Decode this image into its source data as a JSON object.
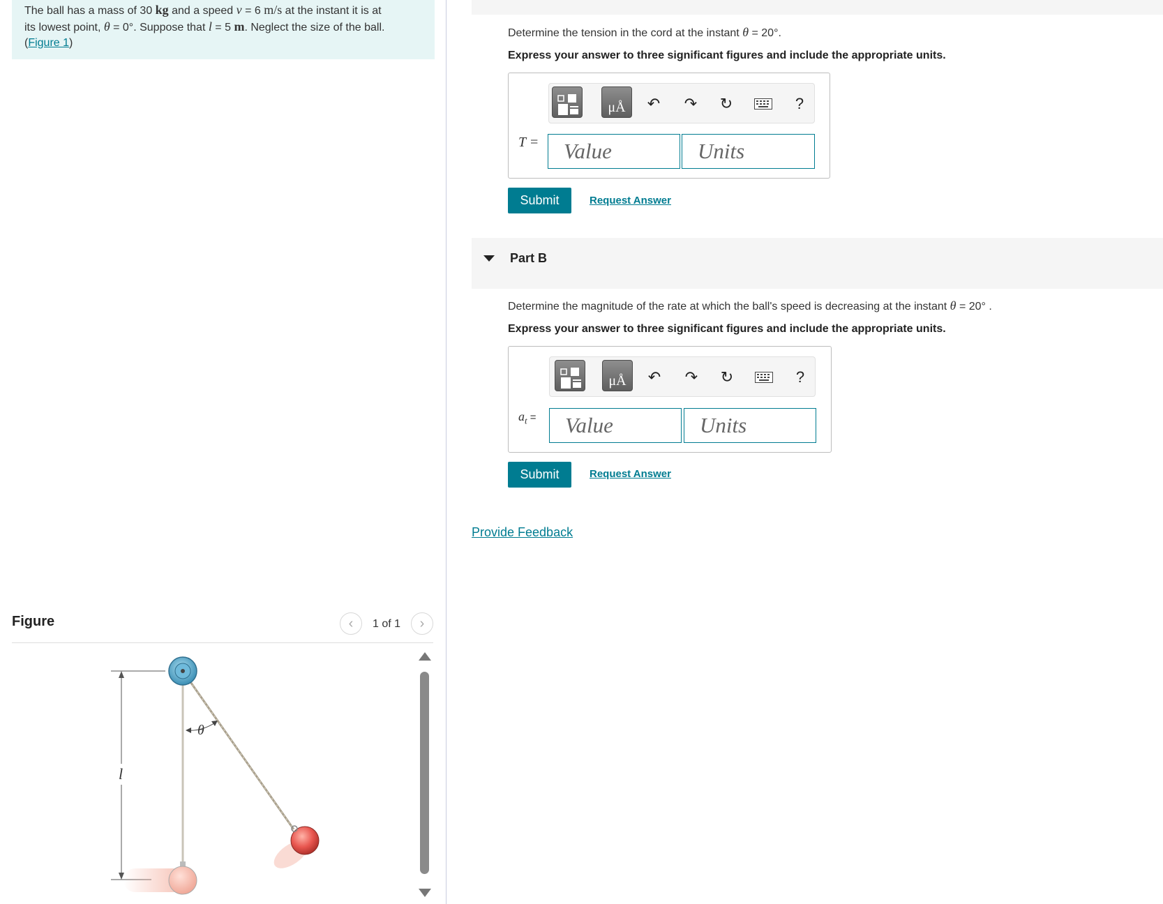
{
  "problem": {
    "text_1": "The ball has a mass of 30 ",
    "mass_unit": "kg",
    "text_2": " and a speed ",
    "speed_var": "v",
    "text_3": " = 6 ",
    "speed_unit": "m/s",
    "text_4": " at the instant it is at",
    "text_5": "its lowest point, ",
    "theta": "θ",
    "text_6": " = 0°. Suppose that ",
    "length_var": "l",
    "text_7": " = 5 ",
    "length_unit": "m",
    "text_8": ". Neglect the size of the ball.",
    "figure_open": "(",
    "figure_link": "Figure 1",
    "figure_close": ")"
  },
  "figure": {
    "title": "Figure",
    "count": "1 of 1",
    "prev_icon": "chevron-left-icon",
    "next_icon": "chevron-right-icon",
    "label_theta": "θ",
    "label_l": "l"
  },
  "part_a": {
    "question_1": "Determine the tension in the cord at the instant ",
    "theta": "θ",
    "question_2": " = 20°.",
    "instructions": "Express your answer to three significant figures and include the appropriate units.",
    "var_label": "T =",
    "value_placeholder": "Value",
    "units_placeholder": "Units",
    "submit_label": "Submit",
    "request_label": "Request Answer"
  },
  "part_b": {
    "title": "Part B",
    "question_1": "Determine the magnitude of the rate at which the ball's speed is decreasing at the instant ",
    "theta": "θ",
    "question_2": " = 20° .",
    "instructions": "Express your answer to three significant figures and include the appropriate units.",
    "var_label": "a",
    "var_sub": "t",
    "var_eq": " =",
    "value_placeholder": "Value",
    "units_placeholder": "Units",
    "submit_label": "Submit",
    "request_label": "Request Answer"
  },
  "toolbar": {
    "units_glyph": "μÅ",
    "help": "?",
    "icons": [
      "templates-icon",
      "units-icon",
      "undo-icon",
      "redo-icon",
      "reset-icon",
      "keyboard-icon",
      "help-icon"
    ]
  },
  "feedback_label": "Provide Feedback",
  "colors": {
    "accent": "#007c91",
    "problem_bg": "#e6f5f5",
    "ball": "#e8564f"
  }
}
